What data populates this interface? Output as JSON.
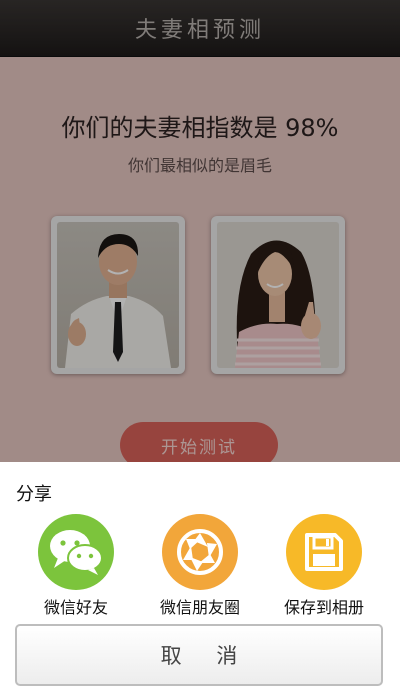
{
  "header": {
    "title": "夫妻相预测"
  },
  "result": {
    "headline": "你们的夫妻相指数是 98%",
    "subtitle": "你们最相似的是眉毛",
    "start_button": "开始测试"
  },
  "share": {
    "title": "分享",
    "items": [
      {
        "label": "微信好友",
        "icon": "wechat-icon",
        "color": "#7cc43c"
      },
      {
        "label": "微信朋友圈",
        "icon": "moments-aperture-icon",
        "color": "#f2a63a"
      },
      {
        "label": "保存到相册",
        "icon": "save-floppy-icon",
        "color": "#f7b928"
      }
    ],
    "cancel": "取 消"
  }
}
